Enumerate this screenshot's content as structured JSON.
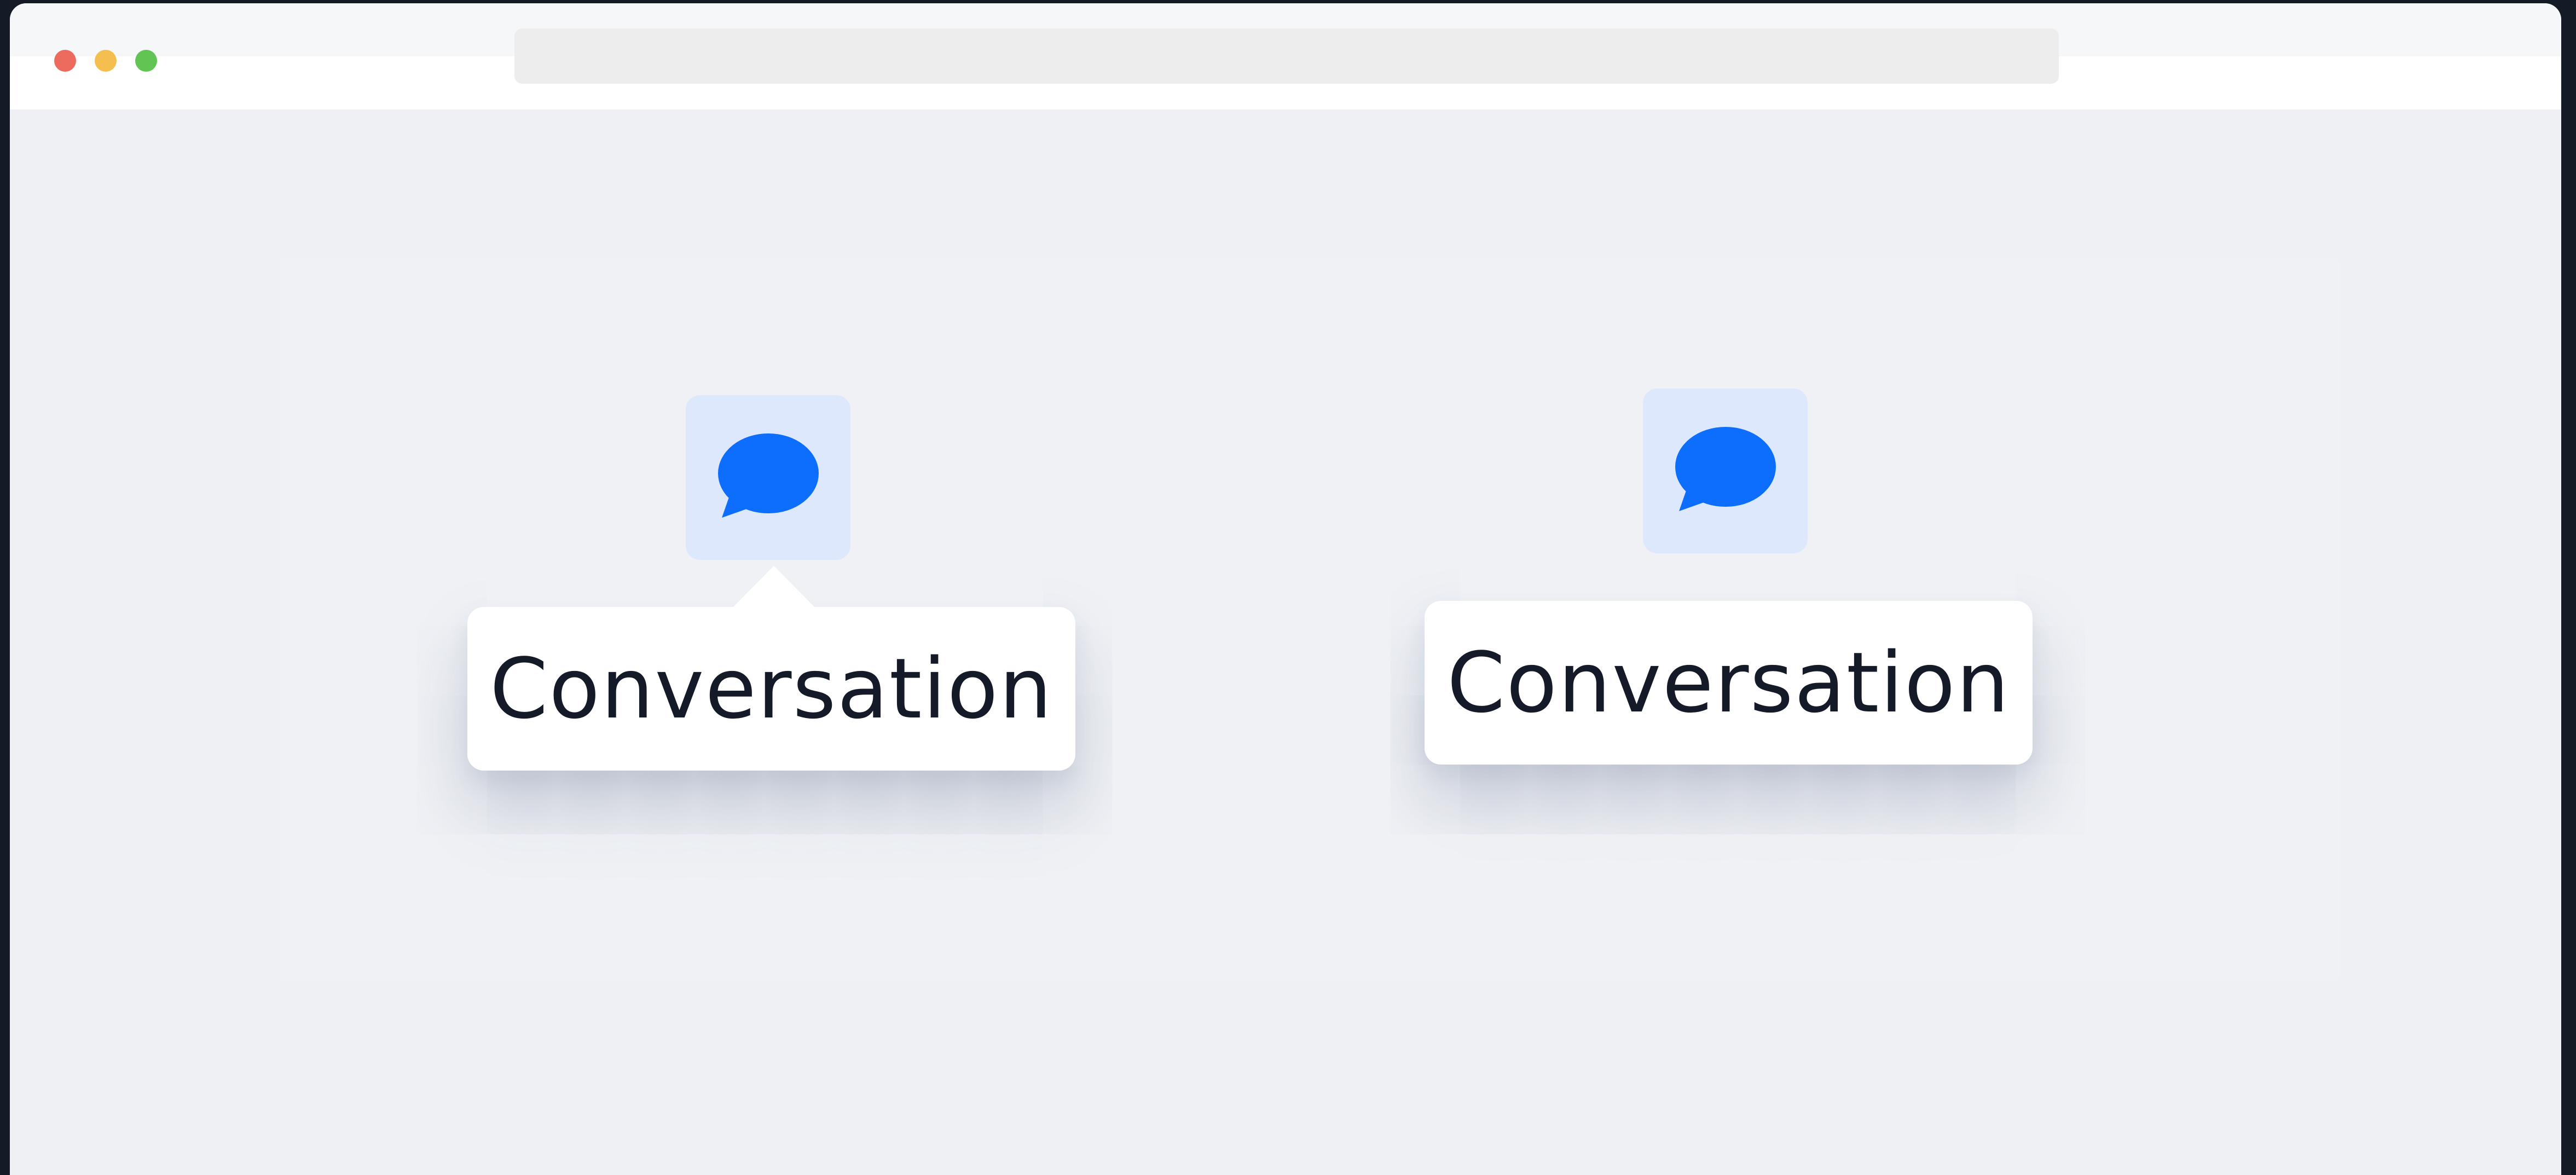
{
  "colors": {
    "backdrop": "#141b26",
    "canvas": "#eff0f4",
    "icon_tile": "#dde8fd",
    "icon": "#0d6efd",
    "tooltip_bg": "#ffffff",
    "tooltip_text": "#151a29"
  },
  "window": {
    "traffic_lights": [
      "close",
      "minimize",
      "zoom"
    ],
    "address_bar": ""
  },
  "examples": [
    {
      "icon": "chat-bubble-icon",
      "tooltip": {
        "label": "Conversation",
        "has_arrow": true
      }
    },
    {
      "icon": "chat-bubble-icon",
      "tooltip": {
        "label": "Conversation",
        "has_arrow": false
      }
    }
  ]
}
